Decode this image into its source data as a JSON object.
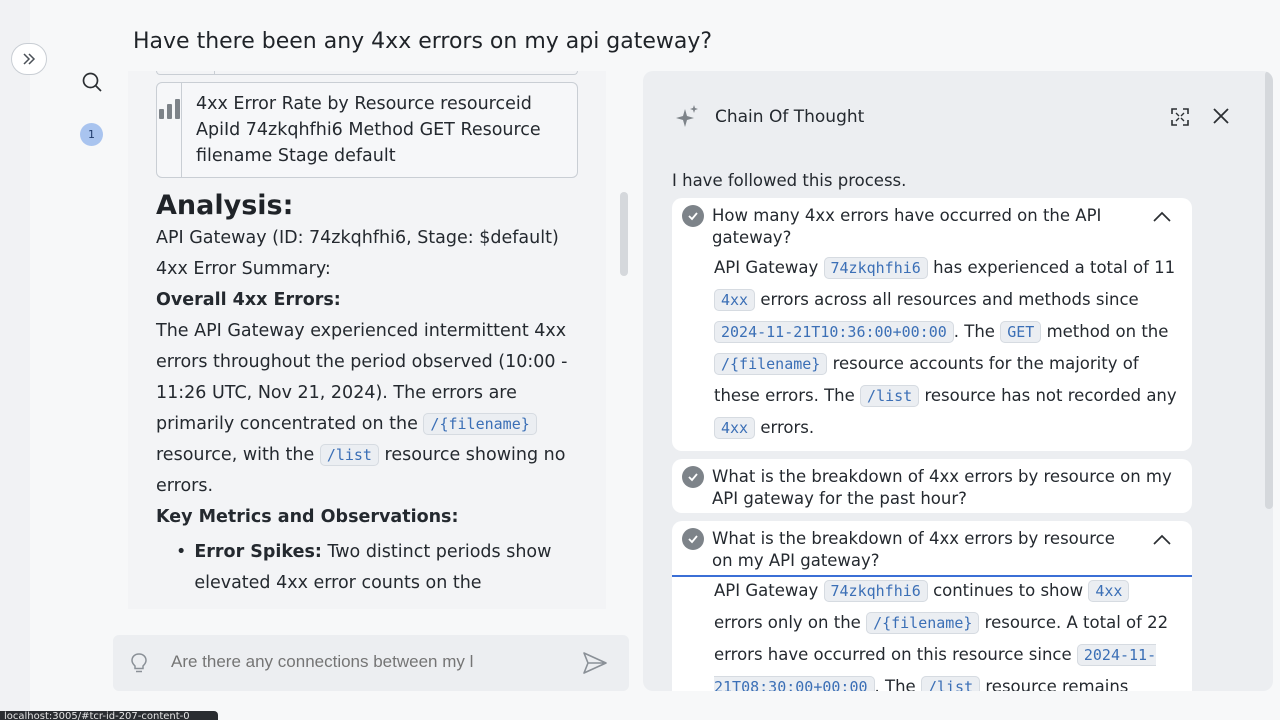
{
  "header": {
    "question": "Have there been any 4xx errors on my api gateway?",
    "badge_count": "1"
  },
  "chat": {
    "tool_card": "4xx Error Rate by Resource resourceid ApiId 74zkqhfhi6 Method GET Resource filename Stage default",
    "analysis_heading": "Analysis:",
    "summary_line1": "API Gateway (ID: 74zkqhfhi6, Stage: $default)",
    "summary_line2": "4xx Error Summary:",
    "overall_heading": "Overall 4xx Errors:",
    "overall_text_a": "The API Gateway experienced intermittent 4xx errors throughout the period observed (10:00 - 11:26 UTC, Nov 21, 2024). The errors are primarily concentrated on the",
    "code_filename": "/{filename}",
    "overall_text_b": "resource, with the",
    "code_list": "/list",
    "overall_text_c": "resource showing no errors.",
    "metrics_heading": "Key Metrics and Observations:",
    "bullet_label": "Error Spikes:",
    "bullet_text": "Two distinct periods show elevated 4xx error counts on the"
  },
  "input": {
    "placeholder": "Are there any connections between my l"
  },
  "cot": {
    "title": "Chain Of Thought",
    "intro": "I have followed this process.",
    "steps": [
      {
        "question": "How many 4xx errors have occurred on the API gateway?",
        "a1": "API Gateway",
        "c1": "74zkqhfhi6",
        "a2": "has experienced a total of 11",
        "c2": "4xx",
        "a3": "errors across all resources and methods since",
        "c3": "2024-11-21T10:36:00+00:00",
        "a4": ". The",
        "c4": "GET",
        "a5": "method on the",
        "c5": "/{filename}",
        "a6": "resource accounts for the majority of these errors. The",
        "c6": "/list",
        "a7": "resource has not recorded any",
        "c7": "4xx",
        "a8": "errors."
      },
      {
        "question": "What is the breakdown of 4xx errors by resource on my API gateway for the past hour?"
      },
      {
        "question": "What is the breakdown of 4xx errors by resource on my API gateway?",
        "a1": "API Gateway",
        "c1": "74zkqhfhi6",
        "a2": "continues to show",
        "c2": "4xx",
        "a3": "errors only on the",
        "c3": "/{filename}",
        "a4": "resource. A total of 22 errors have occurred on this resource since",
        "c4": "2024-11-21T08:30:00+00:00",
        "a5": ". The",
        "c5": "/list",
        "a6": "resource remains"
      }
    ]
  },
  "status_bar": "localhost:3005/#tcr-id-207-content-0",
  "colors": {
    "accent": "#3b6fd6",
    "code_text": "#3b6fb6",
    "badge": "#a9c4ef"
  },
  "icons": [
    "chevrons-right-icon",
    "search-icon",
    "bar-chart-icon",
    "lightbulb-icon",
    "send-icon",
    "sparkles-icon",
    "expand-icon",
    "close-icon",
    "check-circle-icon",
    "chevron-up-icon"
  ]
}
